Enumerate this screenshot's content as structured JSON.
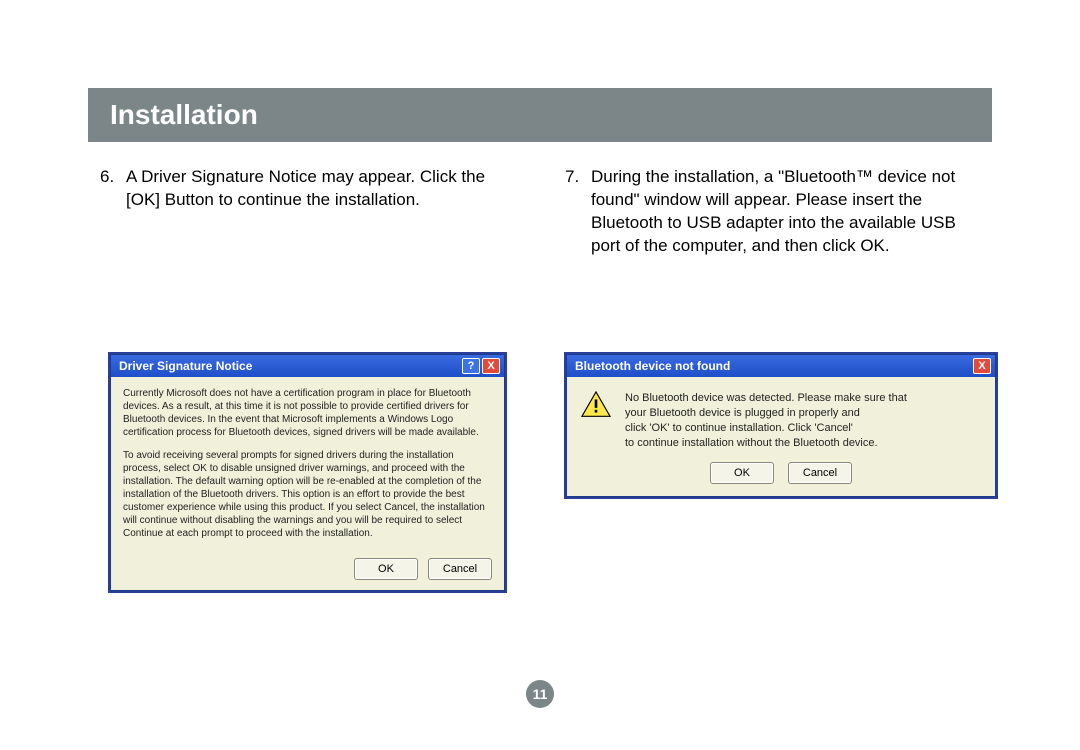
{
  "header": {
    "title": "Installation"
  },
  "steps": {
    "left": {
      "num": "6.",
      "text": "A Driver Signature Notice may appear. Click the [OK] Button to continue the installation."
    },
    "right": {
      "num": "7.",
      "text": "During the installation, a \"Bluetooth™ device not found\" window will appear.  Please insert the Bluetooth to USB adapter into the available USB port of the computer, and then click OK."
    }
  },
  "dialog1": {
    "title": "Driver Signature Notice",
    "help": "?",
    "close": "X",
    "para1": "Currently Microsoft does not have a certification program in place for Bluetooth devices. As a result, at this time it is not possible to provide certified drivers for Bluetooth devices. In the event that Microsoft implements a Windows Logo certification process for Bluetooth devices, signed drivers will be made available.",
    "para2": "To avoid receiving several prompts for signed drivers during the installation process, select OK to disable unsigned driver warnings, and proceed with the installation. The default warning option will be re-enabled at the completion of the installation of the Bluetooth drivers. This option is an effort to provide the best customer experience while using this product. If you select Cancel, the installation will continue without disabling the warnings and you will be required to select Continue at each prompt to proceed with the installation.",
    "ok": "OK",
    "cancel": "Cancel"
  },
  "dialog2": {
    "title": "Bluetooth device not found",
    "close": "X",
    "line1": "No Bluetooth device was detected. Please make sure that",
    "line2": "your Bluetooth device is plugged in properly and",
    "line3": "click 'OK' to continue installation. Click 'Cancel'",
    "line4": "to continue installation without the Bluetooth device.",
    "ok": "OK",
    "cancel": "Cancel"
  },
  "page": {
    "number": "11"
  }
}
